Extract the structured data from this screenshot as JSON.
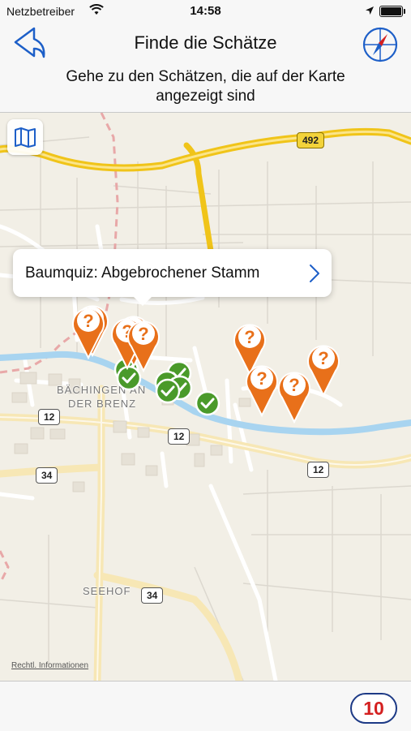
{
  "status_bar": {
    "carrier": "Netzbetreiber",
    "time": "14:58",
    "battery_level": 0.92
  },
  "nav": {
    "title": "Finde die Schätze",
    "subtitle": "Gehe zu den Schätzen, die auf der Karte angezeigt sind",
    "back_icon": "back-arrow-icon",
    "compass_icon": "compass-icon"
  },
  "map": {
    "map_type_icon": "map-icon",
    "roads": {
      "road_492": "492",
      "road_12_a": "12",
      "road_12_b": "12",
      "road_12_c": "12",
      "road_34_a": "34",
      "road_34_b": "34"
    },
    "places": {
      "town_line1": "BÄCHINGEN AN",
      "town_line2": "DER BRENZ",
      "seehof": "SEEHOF"
    },
    "legal_link": "Rechtl. Informationen",
    "callout": {
      "title": "Baumquiz: Abgebrochener Stamm",
      "icon": "chevron-right-icon"
    },
    "treasure_pins": {
      "count": 9,
      "icon": "question-pin-icon",
      "color": "#e8701a"
    },
    "found_markers": {
      "count": 6,
      "icon": "checkmark-icon",
      "color": "#4a9a2a"
    }
  },
  "bottom": {
    "counter": "10"
  },
  "colors": {
    "accent_blue": "#1d5fc8",
    "counter_red": "#d42020",
    "counter_border": "#1d3a86"
  }
}
